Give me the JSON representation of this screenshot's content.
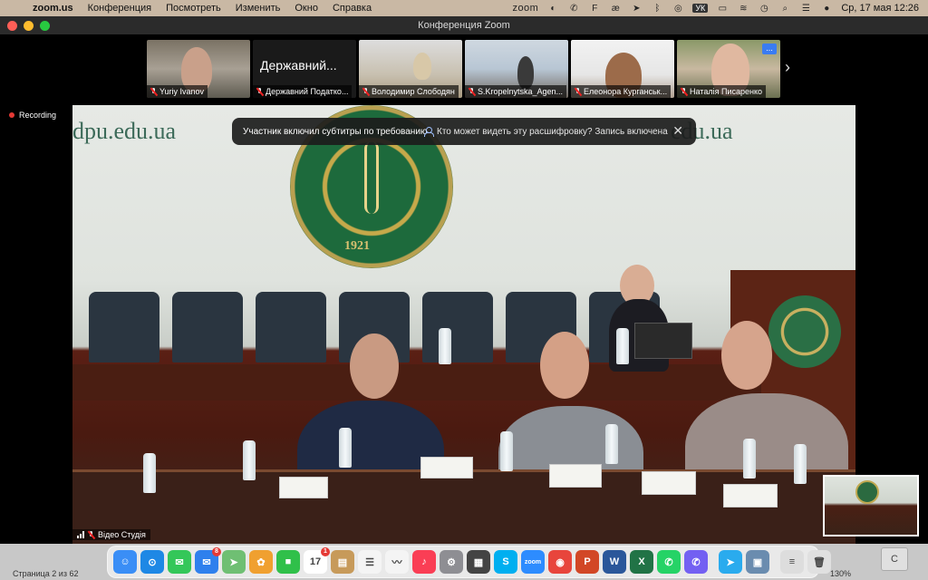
{
  "menubar": {
    "app_name": "zoom.us",
    "items": [
      "Конференция",
      "Посмотреть",
      "Изменить",
      "Окно",
      "Справка"
    ],
    "zoom_label": "zoom",
    "keyboard_layout": "УК",
    "datetime": "Ср, 17 мая  12:26"
  },
  "window": {
    "title": "Конференция Zoom"
  },
  "participants": [
    {
      "name": "Yuriy Ivanov",
      "muted": true,
      "video": true
    },
    {
      "name": "Державний Податко...",
      "display_name": "Державний...",
      "muted": true,
      "video": false
    },
    {
      "name": "Володимир Слободян",
      "muted": true,
      "video": true
    },
    {
      "name": "S.Kropelnytska_Agen...",
      "muted": true,
      "video": true
    },
    {
      "name": "Елеонора Курганськ...",
      "muted": true,
      "video": true
    },
    {
      "name": "Наталія Писаренко",
      "muted": true,
      "video": true,
      "more_menu": "..."
    }
  ],
  "recording": {
    "label": "Recording"
  },
  "toast": {
    "message": "Участник включил субтитры по требованию",
    "who_can_see": "Кто может видеть эту расшифровку? Запись включена",
    "close": "✕"
  },
  "main_video": {
    "wall_text_left": "dpu.edu.ua",
    "wall_text_right": "edu.ua",
    "emblem_year": "1921",
    "label": "Відео Студія"
  },
  "statusbar": {
    "page": "Страница 2 из 62",
    "zoom": "130%"
  },
  "dock": {
    "apps": [
      {
        "name": "finder",
        "glyph": "☺",
        "color": "#3a8ef6"
      },
      {
        "name": "safari",
        "glyph": "⊙",
        "color": "#1e88e5"
      },
      {
        "name": "messages",
        "glyph": "✉",
        "color": "#34c759"
      },
      {
        "name": "mail",
        "glyph": "✉",
        "color": "#2f80ed",
        "badge": "8"
      },
      {
        "name": "maps",
        "glyph": "➤",
        "color": "#6fbf73"
      },
      {
        "name": "photos",
        "glyph": "✿",
        "color": "#f0a030"
      },
      {
        "name": "facetime",
        "glyph": "■",
        "color": "#30c04a"
      },
      {
        "name": "calendar",
        "glyph": "17",
        "color": "#ffffff",
        "badge": "1"
      },
      {
        "name": "notes-app",
        "glyph": "▤",
        "color": "#c79a5a"
      },
      {
        "name": "reminders",
        "glyph": "☰",
        "color": "#f4f4f4"
      },
      {
        "name": "freeform",
        "glyph": "〰",
        "color": "#f4f4f4"
      },
      {
        "name": "music",
        "glyph": "♪",
        "color": "#fa3e55"
      },
      {
        "name": "settings",
        "glyph": "⚙",
        "color": "#8e8e93"
      },
      {
        "name": "calculator",
        "glyph": "▦",
        "color": "#444444"
      },
      {
        "name": "skype",
        "glyph": "S",
        "color": "#00aff0"
      },
      {
        "name": "zoom",
        "glyph": "zoom",
        "color": "#2d8cff"
      },
      {
        "name": "chrome",
        "glyph": "◉",
        "color": "#e8453c"
      },
      {
        "name": "powerpoint",
        "glyph": "P",
        "color": "#d24726"
      },
      {
        "name": "word",
        "glyph": "W",
        "color": "#2b579a"
      },
      {
        "name": "excel",
        "glyph": "X",
        "color": "#217346"
      },
      {
        "name": "whatsapp",
        "glyph": "✆",
        "color": "#25d366"
      },
      {
        "name": "viber",
        "glyph": "✆",
        "color": "#7360f2"
      },
      {
        "name": "telegram",
        "glyph": "➤",
        "color": "#2aabee"
      },
      {
        "name": "preview",
        "glyph": "▣",
        "color": "#6a8caf"
      },
      {
        "name": "downloads",
        "glyph": "≡",
        "color": "#dddddd"
      },
      {
        "name": "trash",
        "glyph": "🗑",
        "color": "#e0e0e0"
      }
    ],
    "right_doc": "C"
  }
}
